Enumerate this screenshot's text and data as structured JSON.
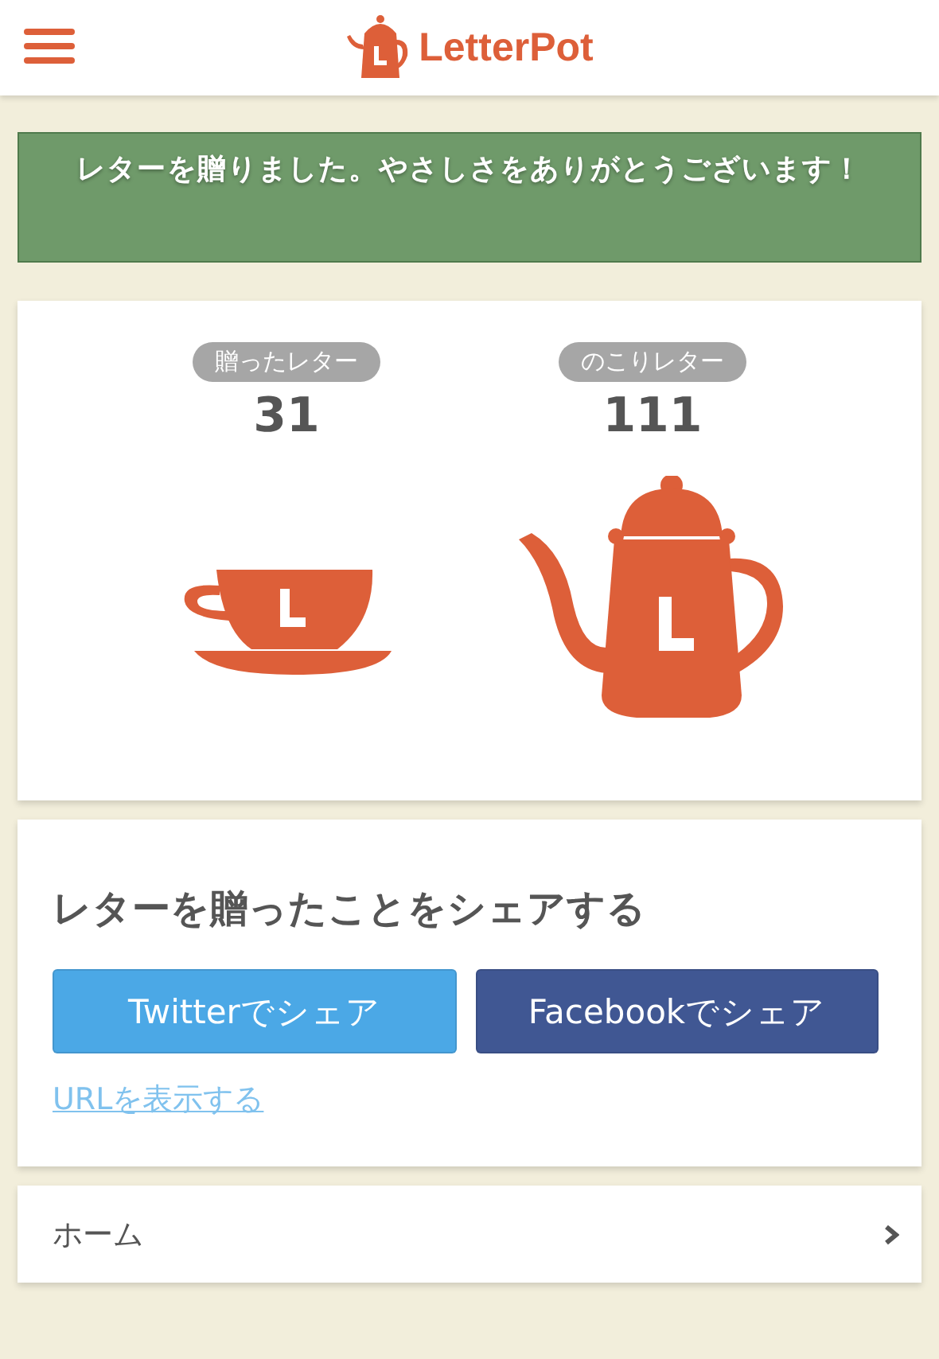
{
  "header": {
    "brand": "LetterPot"
  },
  "banner": {
    "message": "レターを贈りました。やさしさをありがとうございます！"
  },
  "stats": [
    {
      "kind": "cup",
      "label": "贈ったレター",
      "count": "31"
    },
    {
      "kind": "pot",
      "label": "のこりレター",
      "count": "111"
    }
  ],
  "share": {
    "title": "レターを贈ったことをシェアする",
    "buttons": [
      {
        "kind": "twitter",
        "label": "Twitterでシェア"
      },
      {
        "kind": "facebook",
        "label": "Facebookでシェア"
      }
    ],
    "link": "URLを表示する"
  },
  "nav": [
    {
      "label": "ホーム"
    }
  ]
}
